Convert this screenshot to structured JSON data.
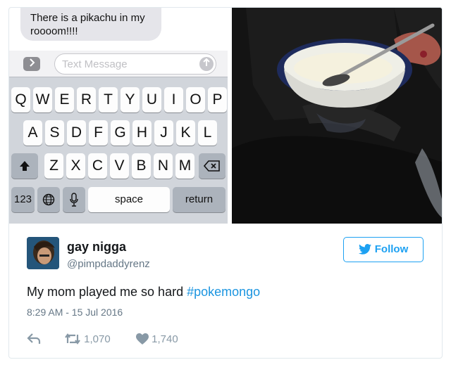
{
  "messages": {
    "bubble_text": "There is a pikachu in my\nroooom!!!!",
    "input_placeholder": "Text Message",
    "expand_icon": "chevron-right-icon",
    "send_icon": "arrow-up-icon"
  },
  "keyboard": {
    "row1": [
      "Q",
      "W",
      "E",
      "R",
      "T",
      "Y",
      "U",
      "I",
      "O",
      "P"
    ],
    "row2": [
      "A",
      "S",
      "D",
      "F",
      "G",
      "H",
      "J",
      "K",
      "L"
    ],
    "row3": [
      "Z",
      "X",
      "C",
      "V",
      "B",
      "N",
      "M"
    ],
    "numbers_label": "123",
    "space_label": "space",
    "return_label": "return"
  },
  "tweet": {
    "display_name": "gay nigga",
    "handle": "@pimpdaddyrenz",
    "follow_label": "Follow",
    "text": "My mom played me so hard",
    "hashtag": "#pokemongo",
    "timestamp": "8:29 AM - 15 Jul 2016",
    "retweets": "1,070",
    "likes": "1,740",
    "accent_color": "#1da1f2"
  }
}
